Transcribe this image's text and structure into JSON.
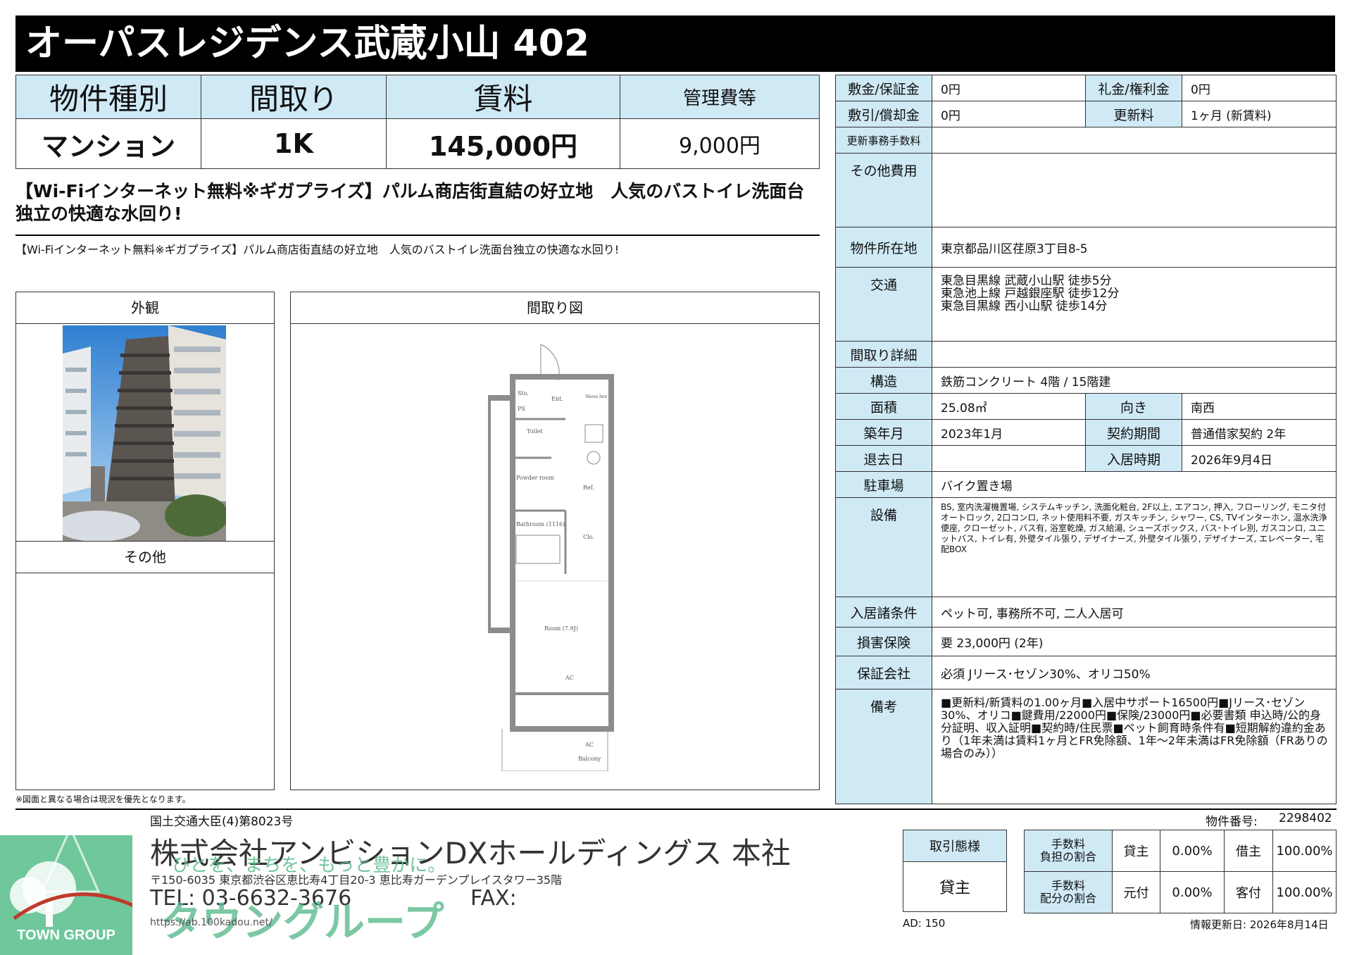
{
  "title": "オーパスレジデンス武蔵小山 402",
  "summary": {
    "headers": [
      "物件種別",
      "間取り",
      "賃料",
      "管理費等"
    ],
    "values": [
      "マンション",
      "1K",
      "145,000円",
      "9,000円"
    ]
  },
  "catchcopy": "【Wi-Fiインターネット無料※ギガプライズ】パルム商店街直結の好立地　人気のバストイレ洗面台独立の快適な水回り!",
  "subcopy": "【Wi-Fiインターネット無料※ギガプライズ】パルム商店街直結の好立地　人気のバストイレ洗面台独立の快適な水回り!",
  "panels": {
    "exterior_label": "外観",
    "other_label": "その他",
    "floorplan_label": "間取り図",
    "note": "※図面と異なる場合は現況を優先となります。"
  },
  "floorplan": {
    "sto": "Sto.",
    "ent": "Ent.",
    "shoes": "Shoes box",
    "ps": "PS",
    "toilet": "Toilet",
    "powder": "Powder room",
    "bath": "Bathroom (1116)",
    "ref": "Ref.",
    "clo": "Clo.",
    "room": "Room (7.9J)",
    "ac": "AC",
    "balcony": "Balcony"
  },
  "details": {
    "shikikin_label": "敷金/保証金",
    "shikikin": "0円",
    "reikin_label": "礼金/権利金",
    "reikin": "0円",
    "shikibiki_label": "敷引/償却金",
    "shikibiki": "0円",
    "koshin_label": "更新料",
    "koshin": "1ヶ月 (新賃料)",
    "jimu_label": "更新事務手数料",
    "jimu": "",
    "sonota_label": "その他費用",
    "sonota": "",
    "address_label": "物件所在地",
    "address": "東京都品川区荏原3丁目8-5",
    "kotsu_label": "交通",
    "kotsu": [
      "東急目黒線 武蔵小山駅 徒歩5分",
      "東急池上線 戸越銀座駅 徒歩12分",
      "東急目黒線 西小山駅 徒歩14分"
    ],
    "madori_label": "間取り詳細",
    "madori": "",
    "kozo_label": "構造",
    "kozo": "鉄筋コンクリート 4階 / 15階建",
    "menseki_label": "面積",
    "menseki": "25.08㎡",
    "muki_label": "向き",
    "muki": "南西",
    "chiku_label": "築年月",
    "chiku": "2023年1月",
    "keiyaku_label": "契約期間",
    "keiyaku": "普通借家契約 2年",
    "taikyo_label": "退去日",
    "taikyo": "",
    "nyukyo_label": "入居時期",
    "nyukyo": "2026年9月4日",
    "parking_label": "駐車場",
    "parking": "バイク置き場",
    "setsubi_label": "設備",
    "setsubi": "BS, 室内洗濯機置場, システムキッチン, 洗面化粧台, 2F以上, エアコン, 押入, フローリング, モニタ付オートロック, 2口コンロ, ネット使用料不要, ガスキッチン, シャワー, CS, TVインターホン, 温水洗浄便座, クローゼット, バス有, 浴室乾燥, ガス給湯, シューズボックス, バス･トイレ別, ガスコンロ, ユニットバス, トイレ有, 外壁タイル張り, デザイナーズ, 外壁タイル張り, デザイナーズ, エレベーター, 宅配BOX",
    "joken_label": "入居諸条件",
    "joken": "ペット可, 事務所不可, 二人入居可",
    "hoken_label": "損害保険",
    "hoken": "要 23,000円 (2年)",
    "hosho_label": "保証会社",
    "hosho": "必須 Jリース･セゾン30%、オリコ50%",
    "biko_label": "備考",
    "biko": "■更新料/新賃料の1.00ヶ月■入居中サポート16500円■Jリース･セゾン30%、オリコ■鍵費用/22000円■保険/23000円■必要書類 申込時/公的身分証明、収入証明■契約時/住民票■ペット飼育時条件有■短期解約違約金あり（1年未満は賃料1ヶ月とFR免除額、1年〜2年未満はFR免除額（FRありの場合のみ））"
  },
  "footer": {
    "license": "国土交通大臣(4)第8023号",
    "company": "株式会社アンビションDXホールディングス 本社",
    "slogan": "ひとを、まちを、もっと豊かに。",
    "address": "〒150-6035 東京都渋谷区恵比寿4丁目20-3 恵比寿ガーデンプレイスタワー35階",
    "tel": "TEL: 03-6632-3676",
    "fax": "FAX:",
    "url": "https://ab.100kadou.net/",
    "brand_kana": "タウングループ",
    "logo_text": "TOWN GROUP",
    "property_no_label": "物件番号:",
    "property_no": "2298402",
    "torihiki_label": "取引態様",
    "torihiki": "貸主",
    "fee_burden_label": "手数料\n負担の割合",
    "fee_share_label": "手数料\n配分の割合",
    "kashinushi": "貸主",
    "karinushi": "借主",
    "motozuke": "元付",
    "kyakuzuke": "客付",
    "pct_kashi": "0.00%",
    "pct_kari": "100.00%",
    "pct_moto": "0.00%",
    "pct_kyaku": "100.00%",
    "ad": "AD: 150",
    "updated": "情報更新日: 2026年8月14日"
  },
  "colors": {
    "header_bg": "#000000",
    "label_bg": "#cfe9f5",
    "brand_green": "#5cba8e",
    "logo_bg": "#6fc79c"
  }
}
